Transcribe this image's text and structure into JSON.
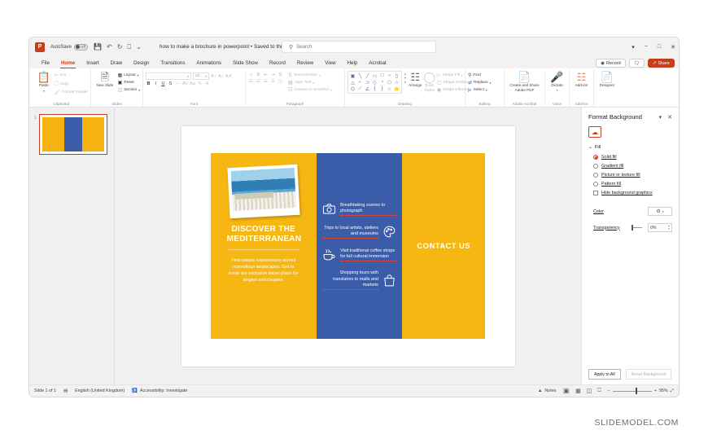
{
  "titlebar": {
    "app_icon": "powerpoint-icon",
    "autosave_label": "AutoSave",
    "autosave_state": "Off",
    "document_title": "how to make a brochure in powerpoint • Saved to this PC",
    "quick_access": [
      {
        "name": "save-icon",
        "glyph": "⭳"
      },
      {
        "name": "undo-icon",
        "glyph": "↶"
      },
      {
        "name": "redo-icon",
        "glyph": "↻"
      },
      {
        "name": "present-icon",
        "glyph": "⬇"
      },
      {
        "name": "customize-qat-icon",
        "glyph": "⌄"
      }
    ],
    "search_placeholder": "Search",
    "window_controls": [
      {
        "name": "ribbon-display-options-icon",
        "glyph": "▾"
      },
      {
        "name": "minimize-icon",
        "glyph": "−"
      },
      {
        "name": "restore-icon",
        "glyph": "□"
      },
      {
        "name": "close-icon",
        "glyph": "✕"
      }
    ]
  },
  "tabs": [
    {
      "label": "File",
      "active": false
    },
    {
      "label": "Home",
      "active": true
    },
    {
      "label": "Insert",
      "active": false
    },
    {
      "label": "Draw",
      "active": false
    },
    {
      "label": "Design",
      "active": false
    },
    {
      "label": "Transitions",
      "active": false
    },
    {
      "label": "Animations",
      "active": false
    },
    {
      "label": "Slide Show",
      "active": false
    },
    {
      "label": "Record",
      "active": false
    },
    {
      "label": "Review",
      "active": false
    },
    {
      "label": "View",
      "active": false
    },
    {
      "label": "Help",
      "active": false
    },
    {
      "label": "Acrobat",
      "active": false
    }
  ],
  "tab_right": {
    "record_label": "Record",
    "comments_label": "",
    "share_label": "Share"
  },
  "ribbon": {
    "clipboard": {
      "group_label": "Clipboard",
      "paste_label": "Paste",
      "items": [
        {
          "label": "Cut",
          "icon": "scissors-icon"
        },
        {
          "label": "Copy",
          "icon": "copy-icon"
        },
        {
          "label": "Format Painter",
          "icon": "paintbrush-icon"
        }
      ]
    },
    "slides": {
      "group_label": "Slides",
      "new_slide_label": "New Slide",
      "items": [
        {
          "label": "Layout",
          "icon": "layout-icon"
        },
        {
          "label": "Reset",
          "icon": "reset-icon"
        },
        {
          "label": "Section",
          "icon": "section-icon"
        }
      ]
    },
    "font": {
      "group_label": "Font",
      "font_name": "",
      "font_size": "24",
      "buttons": [
        "B",
        "I",
        "U",
        "S",
        "abc",
        "AV",
        "Aa",
        "A",
        "A"
      ]
    },
    "paragraph": {
      "group_label": "Paragraph",
      "items": [
        {
          "label": "Text Direction",
          "icon": "text-direction-icon"
        },
        {
          "label": "Align Text",
          "icon": "align-text-icon"
        },
        {
          "label": "Convert to SmartArt",
          "icon": "smartart-icon"
        }
      ]
    },
    "drawing": {
      "group_label": "Drawing",
      "arrange_label": "Arrange",
      "quick_styles_label": "Quick Styles",
      "items": [
        {
          "label": "Shape Fill",
          "icon": "shape-fill-icon"
        },
        {
          "label": "Shape Outline",
          "icon": "shape-outline-icon"
        },
        {
          "label": "Shape Effects",
          "icon": "shape-effects-icon"
        }
      ],
      "shapes": [
        "▣",
        "╲",
        "╱",
        "▭",
        "□",
        "○",
        "▯",
        "△",
        "⌐",
        "⊃",
        "◇",
        "◔",
        "⬠",
        "☆",
        "⌬",
        "⟋",
        "∠",
        "{",
        "}",
        "☆",
        "⭐"
      ]
    },
    "editing": {
      "group_label": "Editing",
      "items": [
        {
          "label": "Find",
          "icon": "search-icon"
        },
        {
          "label": "Replace",
          "icon": "replace-icon"
        },
        {
          "label": "Select",
          "icon": "select-icon"
        }
      ]
    },
    "acrobat": {
      "group_label": "Adobe Acrobat",
      "button_label": "Create and Share Adobe PDF"
    },
    "voice": {
      "group_label": "Voice",
      "button_label": "Dictate"
    },
    "addins": {
      "group_label": "Add-ins",
      "button_label": "Add-ins"
    },
    "designer": {
      "button_label": "Designer"
    }
  },
  "thumbnails": [
    {
      "number": "1",
      "selected": true
    }
  ],
  "slide": {
    "left_panel": {
      "title": "DISCOVER THE MEDITERRANEAN",
      "body": "Find unique experiences across marvellous landscapes. Get to know our exclusive travel plans for singles and couples.",
      "photo_alt": "mediterranean-coastal-town-photo",
      "bg_color": "#f6b713"
    },
    "mid_panel": {
      "bg_color": "#3b5ca8",
      "features": [
        {
          "icon": "camera-icon",
          "text": "Breathtaking scenes to photograph",
          "icon_side": "left"
        },
        {
          "icon": "palette-icon",
          "text": "Trips to local artists, ateliers and museums",
          "icon_side": "right"
        },
        {
          "icon": "coffee-cup-icon",
          "text": "Visit traditional coffee shops for full cultural immersion",
          "icon_side": "left"
        },
        {
          "icon": "shopping-bag-icon",
          "text": "Shopping tours with translators to malls and markets",
          "icon_side": "right"
        }
      ]
    },
    "right_panel": {
      "text": "CONTACT US",
      "bg_color": "#f6b713"
    }
  },
  "format_pane": {
    "title": "Format Background",
    "fill_icon": "fill-bucket-icon",
    "section_label": "Fill",
    "options": [
      {
        "label": "Solid fill",
        "selected": true
      },
      {
        "label": "Gradient fill",
        "selected": false
      },
      {
        "label": "Picture or texture fill",
        "selected": false
      },
      {
        "label": "Pattern fill",
        "selected": false
      }
    ],
    "checkbox_label": "Hide background graphics",
    "color_label": "Color",
    "transparency_label": "Transparency",
    "transparency_value": "0%",
    "apply_all_label": "Apply to All",
    "reset_label": "Reset Background"
  },
  "statusbar": {
    "slide_count": "Slide 1 of 1",
    "language": "English (United Kingdom)",
    "accessibility": "Accessibility: Investigate",
    "notes_label": "Notes",
    "zoom_value": "95%",
    "view_buttons": [
      "normal-view-icon",
      "slide-sorter-icon",
      "reading-view-icon",
      "slideshow-icon"
    ]
  },
  "watermark": "SLIDEMODEL.COM"
}
